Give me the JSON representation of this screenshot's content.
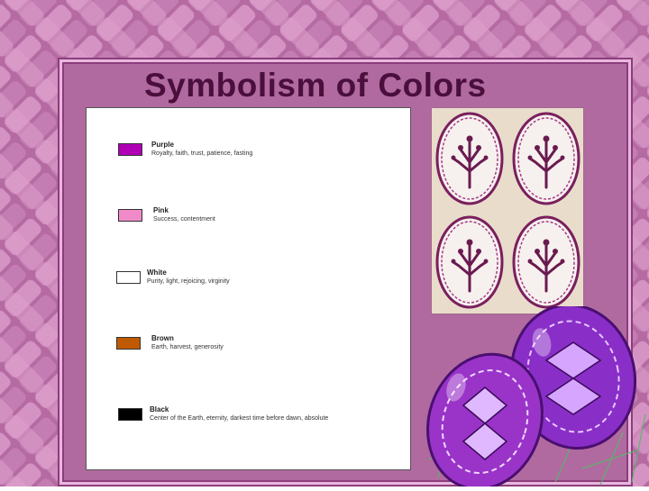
{
  "slide": {
    "title": "Symbolism of Colors"
  },
  "legend": {
    "items": [
      {
        "name": "Purple",
        "description": "Royalty, faith, trust, patience, fasting",
        "color": "#b000b5"
      },
      {
        "name": "Pink",
        "description": "Success, contentment",
        "color": "#f08ac8"
      },
      {
        "name": "White",
        "description": "Purity, light, rejoicing, virginity",
        "color": "#ffffff"
      },
      {
        "name": "Brown",
        "description": "Earth, harvest, generosity",
        "color": "#c05a00"
      },
      {
        "name": "Black",
        "description": "Center of the Earth, eternity, darkest time before dawn, absolute",
        "color": "#000000"
      }
    ]
  },
  "images": {
    "eggs_photo": "pysanky-tree-of-life-eggs",
    "decorative_eggs": "purple-pysanky-eggs-on-grass"
  },
  "theme": {
    "background": "#b76ca4",
    "weave": "#d48fc2",
    "title_color": "#4a0f3c"
  }
}
